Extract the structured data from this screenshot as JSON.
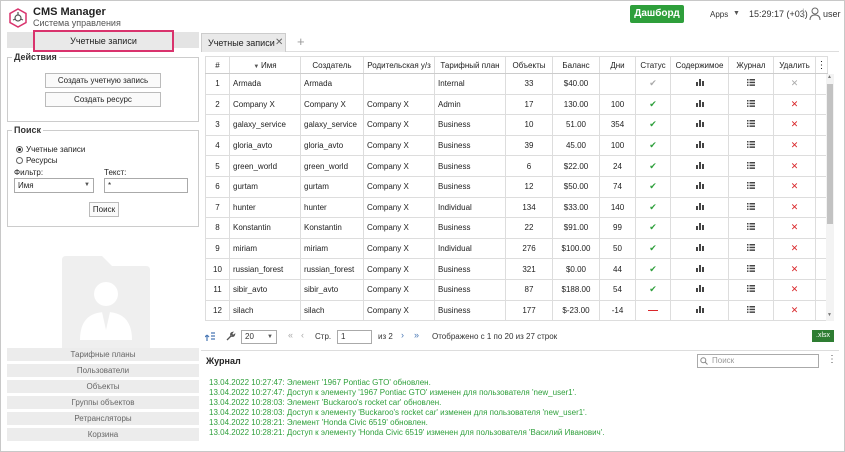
{
  "header": {
    "title": "CMS Manager",
    "subtitle": "Система управления",
    "dashboard_label": "Дашборд",
    "apps_label": "Apps",
    "clock": "15:29:17 (+03)",
    "separator": "|",
    "user": "user"
  },
  "sidebar": {
    "active_tab": "Учетные записи",
    "actions_legend": "Действия",
    "create_account": "Создать учетную запись",
    "create_resource": "Создать ресурс",
    "search_legend": "Поиск",
    "radio_accounts": "Учетные записи",
    "radio_resources": "Ресурсы",
    "filter_label": "Фильтр:",
    "filter_value": "Имя",
    "text_label": "Текст:",
    "text_value": "*",
    "search_button": "Поиск",
    "nav": [
      "Тарифные планы",
      "Пользователи",
      "Объекты",
      "Группы объектов",
      "Ретрансляторы",
      "Корзина"
    ]
  },
  "tabs": {
    "main_tab": "Учетные записи"
  },
  "table": {
    "headers": [
      "#",
      "Имя",
      "Создатель",
      "Родительская у/з",
      "Тарифный план",
      "Объекты",
      "Баланс",
      "Дни",
      "Статус",
      "Содержимое",
      "Журнал",
      "Удалить"
    ],
    "rows": [
      [
        "1",
        "Armada",
        "Armada",
        "",
        "Internal",
        "33",
        "$40.00",
        "",
        "ok-grey",
        "x-grey"
      ],
      [
        "2",
        "Company X",
        "Company X",
        "Company X",
        "Admin",
        "17",
        "130.00",
        "100",
        "ok",
        "x"
      ],
      [
        "3",
        "galaxy_service",
        "galaxy_service",
        "Company X",
        "Business",
        "10",
        "51.00",
        "354",
        "ok",
        "x"
      ],
      [
        "4",
        "gloria_avto",
        "gloria_avto",
        "Company X",
        "Business",
        "39",
        "45.00",
        "100",
        "ok",
        "x"
      ],
      [
        "5",
        "green_world",
        "green_world",
        "Company X",
        "Business",
        "6",
        "$22.00",
        "24",
        "ok",
        "x"
      ],
      [
        "6",
        "gurtam",
        "gurtam",
        "Company X",
        "Business",
        "12",
        "$50.00",
        "74",
        "ok",
        "x"
      ],
      [
        "7",
        "hunter",
        "hunter",
        "Company X",
        "Individual",
        "134",
        "$33.00",
        "140",
        "ok",
        "x"
      ],
      [
        "8",
        "Konstantin",
        "Konstantin",
        "Company X",
        "Business",
        "22",
        "$91.00",
        "99",
        "ok",
        "x"
      ],
      [
        "9",
        "miriam",
        "miriam",
        "Company X",
        "Individual",
        "276",
        "$100.00",
        "50",
        "ok",
        "x"
      ],
      [
        "10",
        "russian_forest",
        "russian_forest",
        "Company X",
        "Business",
        "321",
        "$0.00",
        "44",
        "ok",
        "x"
      ],
      [
        "11",
        "sibir_avto",
        "sibir_avto",
        "Company X",
        "Business",
        "87",
        "$188.00",
        "54",
        "ok",
        "x"
      ],
      [
        "12",
        "silach",
        "silach",
        "Company X",
        "Business",
        "177",
        "$-23.00",
        "-14",
        "dash",
        "x"
      ]
    ]
  },
  "pager": {
    "page_size": "20",
    "page_label": "Стр.",
    "page_value": "1",
    "of_pages": "из 2",
    "summary": "Отображено с 1 по 20 из 27 строк",
    "export": ".xlsx"
  },
  "journal": {
    "title": "Журнал",
    "search_placeholder": "Поиск",
    "lines": [
      "13.04.2022 10:27:47: Элемент '1967 Pontiac GTO' обновлен.",
      "13.04.2022 10:27:47: Доступ к элементу '1967 Pontiac GTO' изменен для пользователя 'new_user1'.",
      "13.04.2022 10:28:03: Элемент 'Buckaroo's rocket car' обновлен.",
      "13.04.2022 10:28:03: Доступ к элементу 'Buckaroo's rocket car' изменен для пользователя 'new_user1'.",
      "13.04.2022 10:28:21: Элемент 'Honda Civic 6519' обновлен.",
      "13.04.2022 10:28:21: Доступ к элементу 'Honda Civic 6519' изменен для пользователя 'Василий Иванович'."
    ]
  },
  "colors": {
    "accent": "#2e9f3b",
    "highlight": "#d9336d",
    "danger": "#d9262a"
  },
  "icons": {
    "status_ok": "check-icon",
    "content": "bar-chart-icon",
    "journal": "list-icon",
    "delete": "close-icon"
  }
}
